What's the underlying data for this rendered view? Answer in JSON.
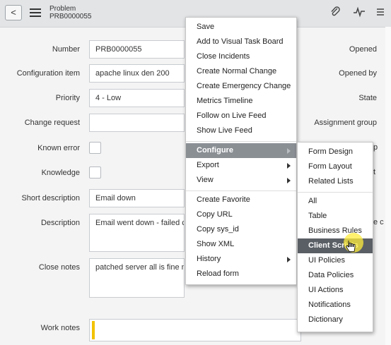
{
  "header": {
    "record_type": "Problem",
    "record_number": "PRB0000055",
    "back_glyph": "<",
    "icons": [
      "back-icon",
      "hamburger-menu-icon",
      "attachment-icon",
      "activity-stream-icon",
      "more-options-icon"
    ]
  },
  "form": {
    "rows": [
      {
        "label": "Number",
        "value": "PRB0000055"
      },
      {
        "label": "Configuration item",
        "value": "apache linux den 200"
      },
      {
        "label": "Priority",
        "value": "4 - Low"
      },
      {
        "label": "Change request",
        "value": ""
      },
      {
        "label": "Known error",
        "checked": false
      },
      {
        "label": "Knowledge",
        "checked": false
      },
      {
        "label": "Short description",
        "value": "Email down"
      },
      {
        "label": "Description",
        "value": "Email went down - failed c"
      },
      {
        "label": "Close notes",
        "value": "patched server all is fine n"
      },
      {
        "label": "Work notes",
        "value": ""
      }
    ],
    "right_labels": [
      "Opened",
      "Opened by",
      "State",
      "Assignment group"
    ],
    "right_edge_fragments": [
      "p",
      "t",
      "e c"
    ]
  },
  "context_menu": {
    "items": [
      {
        "label": "Save"
      },
      {
        "label": "Add to Visual Task Board"
      },
      {
        "label": "Close Incidents"
      },
      {
        "label": "Create Normal Change"
      },
      {
        "label": "Create Emergency Change"
      },
      {
        "label": "Metrics Timeline"
      },
      {
        "label": "Follow on Live Feed"
      },
      {
        "label": "Show Live Feed"
      },
      {
        "label": "Configure",
        "submenu": true,
        "active": true
      },
      {
        "label": "Export",
        "submenu": true
      },
      {
        "label": "View",
        "submenu": true
      },
      {
        "label": "Create Favorite"
      },
      {
        "label": "Copy URL"
      },
      {
        "label": "Copy sys_id"
      },
      {
        "label": "Show XML"
      },
      {
        "label": "History",
        "submenu": true
      },
      {
        "label": "Reload form"
      }
    ]
  },
  "configure_submenu": {
    "items": [
      {
        "label": "Form Design"
      },
      {
        "label": "Form Layout"
      },
      {
        "label": "Related Lists"
      },
      {
        "label": "All"
      },
      {
        "label": "Table"
      },
      {
        "label": "Business Rules"
      },
      {
        "label": "Client Scripts",
        "active": true
      },
      {
        "label": "UI Policies"
      },
      {
        "label": "Data Policies"
      },
      {
        "label": "UI Actions"
      },
      {
        "label": "Notifications"
      },
      {
        "label": "Dictionary"
      }
    ]
  },
  "colors": {
    "header_bg": "#e2e4e6",
    "menu_active_bg": "#8a8f94",
    "submenu_active_bg": "#5a5f65",
    "cursor_highlight": "#ffec3c",
    "work_notes_marker": "#f2c200"
  }
}
